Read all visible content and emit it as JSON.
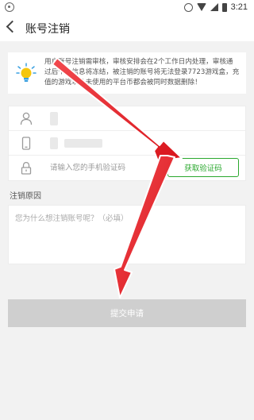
{
  "status_bar": {
    "time": "3:21"
  },
  "header": {
    "title": "账号注销"
  },
  "notice": {
    "text": "用户账号注销需审核，审核安排会在2个工作日内处理，审核通过后个人信息将冻结，被注销的账号将无法登录7723游戏盒，充值的游戏以及未使用的平台币都会被同时数据删除！"
  },
  "form": {
    "code_placeholder": "请输入您的手机验证码",
    "get_code_label": "获取验证码"
  },
  "reason": {
    "label": "注销原因",
    "placeholder": "您为什么想注销账号呢？（必填）"
  },
  "submit_label": "提交申请",
  "colors": {
    "accent_green": "#2aa82e",
    "annotation_red": "#e8232a",
    "disabled_button": "#cfcfcf"
  }
}
